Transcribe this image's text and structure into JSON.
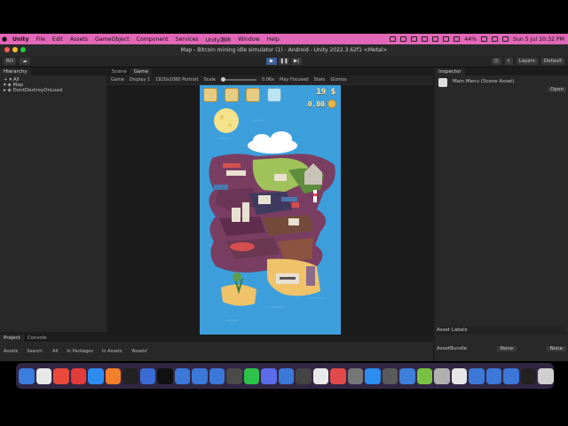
{
  "menubar": {
    "items": [
      "Unity",
      "File",
      "Edit",
      "Assets",
      "GameObject",
      "Component",
      "Services",
      "Unity源码",
      "Window",
      "Help"
    ],
    "battery": "44%",
    "datetime": "Sun 5 Jul  10:32 PM"
  },
  "window": {
    "title": "Map - Bitcoin mining idle simulator (1) - Android - Unity 2022.3.62f1 <Metal>"
  },
  "toolbar": {
    "account": "RD",
    "layers": "Layers",
    "layout": "Default"
  },
  "hierarchy": {
    "tab": "Hierarchy",
    "search": "All",
    "items": [
      "Map",
      "DontDestroyOnLoad"
    ]
  },
  "game_tabs": [
    "Scene",
    "Game"
  ],
  "gamebar": {
    "display_mode": "Game",
    "display": "Display 1",
    "resolution": "1920x1080 Portrait",
    "scale_label": "Scale",
    "scale_value": "0.06x",
    "play_focused": "Play Focused",
    "stats": "Stats",
    "gizmos": "Gizmos"
  },
  "game_hud": {
    "coins": "19 $",
    "btc": "0.00"
  },
  "inspector": {
    "tab": "Inspector",
    "asset": "Main Menu (Scene Asset)",
    "open": "Open",
    "asset_labels": "Asset Labels",
    "asset_bundle": "AssetBundle",
    "bundle_value": "None",
    "variant_value": "None"
  },
  "bottom": {
    "tabs": [
      "Project",
      "Console"
    ],
    "items": [
      "Assets",
      "Search:",
      "All",
      "In Packages",
      "In Assets",
      "'Assets'"
    ]
  },
  "dock_icons": [
    "finder",
    "launchpad",
    "chrome",
    "toolbox",
    "safari",
    "blender",
    "terminal",
    "xcode",
    "unity",
    "vscode",
    "vscode",
    "vscode",
    "mps",
    "wechat",
    "app",
    "vscode",
    "app",
    "app",
    "app",
    "app",
    "zoom",
    "app",
    "app",
    "android",
    "app",
    "app",
    "vscode",
    "vscode",
    "vscode",
    "unity",
    "trash"
  ]
}
